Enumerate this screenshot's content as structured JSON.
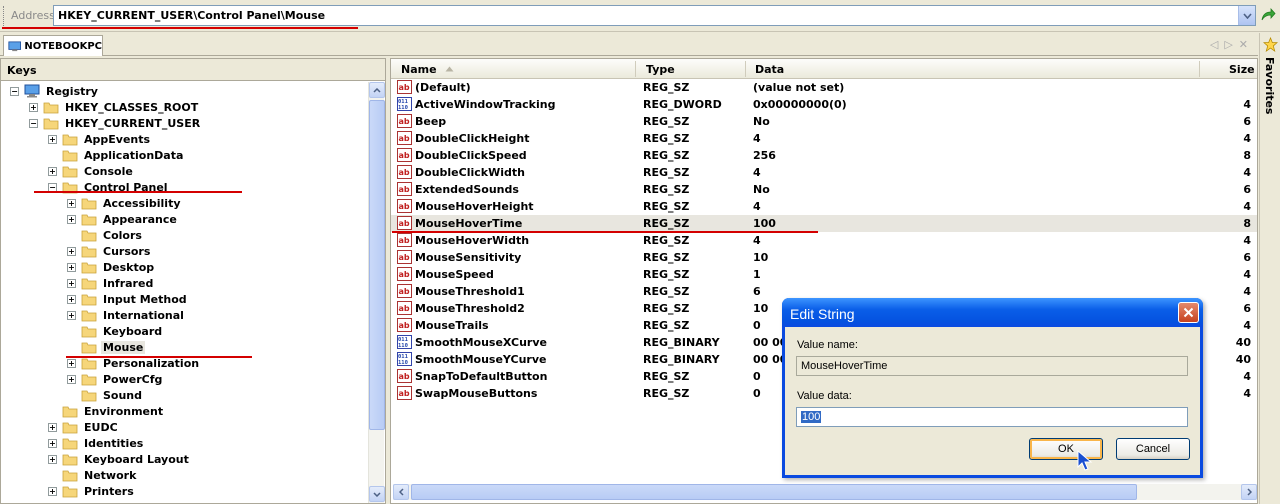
{
  "address": {
    "label": "Address",
    "path": "HKEY_CURRENT_USER\\Control Panel\\Mouse"
  },
  "tab": {
    "label": "NOTEBOOKPC"
  },
  "favorites": {
    "label": "Favorites"
  },
  "keys_pane": {
    "header": "Keys",
    "tree": [
      {
        "label": "Registry",
        "level": 0,
        "expander": "minus",
        "icon": "computer-icon"
      },
      {
        "label": "HKEY_CLASSES_ROOT",
        "level": 1,
        "expander": "plus",
        "icon": "folder-icon"
      },
      {
        "label": "HKEY_CURRENT_USER",
        "level": 1,
        "expander": "minus",
        "icon": "folder-icon"
      },
      {
        "label": "AppEvents",
        "level": 2,
        "expander": "plus",
        "icon": "folder-icon"
      },
      {
        "label": "ApplicationData",
        "level": 2,
        "expander": "none",
        "icon": "folder-icon"
      },
      {
        "label": "Console",
        "level": 2,
        "expander": "plus",
        "icon": "folder-icon"
      },
      {
        "label": "Control Panel",
        "level": 2,
        "expander": "minus",
        "icon": "folder-icon"
      },
      {
        "label": "Accessibility",
        "level": 3,
        "expander": "plus",
        "icon": "folder-icon"
      },
      {
        "label": "Appearance",
        "level": 3,
        "expander": "plus",
        "icon": "folder-icon"
      },
      {
        "label": "Colors",
        "level": 3,
        "expander": "none",
        "icon": "folder-icon"
      },
      {
        "label": "Cursors",
        "level": 3,
        "expander": "plus",
        "icon": "folder-icon"
      },
      {
        "label": "Desktop",
        "level": 3,
        "expander": "plus",
        "icon": "folder-icon"
      },
      {
        "label": "Infrared",
        "level": 3,
        "expander": "plus",
        "icon": "folder-icon"
      },
      {
        "label": "Input Method",
        "level": 3,
        "expander": "plus",
        "icon": "folder-icon"
      },
      {
        "label": "International",
        "level": 3,
        "expander": "plus",
        "icon": "folder-icon"
      },
      {
        "label": "Keyboard",
        "level": 3,
        "expander": "none",
        "icon": "folder-icon"
      },
      {
        "label": "Mouse",
        "level": 3,
        "expander": "none",
        "icon": "folder-icon",
        "selected": true
      },
      {
        "label": "Personalization",
        "level": 3,
        "expander": "plus",
        "icon": "folder-icon"
      },
      {
        "label": "PowerCfg",
        "level": 3,
        "expander": "plus",
        "icon": "folder-icon"
      },
      {
        "label": "Sound",
        "level": 3,
        "expander": "none",
        "icon": "folder-icon"
      },
      {
        "label": "Environment",
        "level": 2,
        "expander": "none",
        "icon": "folder-icon"
      },
      {
        "label": "EUDC",
        "level": 2,
        "expander": "plus",
        "icon": "folder-icon"
      },
      {
        "label": "Identities",
        "level": 2,
        "expander": "plus",
        "icon": "folder-icon"
      },
      {
        "label": "Keyboard Layout",
        "level": 2,
        "expander": "plus",
        "icon": "folder-icon"
      },
      {
        "label": "Network",
        "level": 2,
        "expander": "none",
        "icon": "folder-icon"
      },
      {
        "label": "Printers",
        "level": 2,
        "expander": "plus",
        "icon": "folder-icon"
      }
    ]
  },
  "values_pane": {
    "columns": {
      "name": "Name",
      "type": "Type",
      "data": "Data",
      "size": "Size"
    },
    "rows": [
      {
        "name": "(Default)",
        "type": "REG_SZ",
        "data": "(value not set)",
        "size": "",
        "kind": "string"
      },
      {
        "name": "ActiveWindowTracking",
        "type": "REG_DWORD",
        "data": "0x00000000(0)",
        "size": "4",
        "kind": "binary"
      },
      {
        "name": "Beep",
        "type": "REG_SZ",
        "data": "No",
        "size": "6",
        "kind": "string"
      },
      {
        "name": "DoubleClickHeight",
        "type": "REG_SZ",
        "data": "4",
        "size": "4",
        "kind": "string"
      },
      {
        "name": "DoubleClickSpeed",
        "type": "REG_SZ",
        "data": "256",
        "size": "8",
        "kind": "string"
      },
      {
        "name": "DoubleClickWidth",
        "type": "REG_SZ",
        "data": "4",
        "size": "4",
        "kind": "string"
      },
      {
        "name": "ExtendedSounds",
        "type": "REG_SZ",
        "data": "No",
        "size": "6",
        "kind": "string"
      },
      {
        "name": "MouseHoverHeight",
        "type": "REG_SZ",
        "data": "4",
        "size": "4",
        "kind": "string"
      },
      {
        "name": "MouseHoverTime",
        "type": "REG_SZ",
        "data": "100",
        "size": "8",
        "kind": "string",
        "selected": true
      },
      {
        "name": "MouseHoverWidth",
        "type": "REG_SZ",
        "data": "4",
        "size": "4",
        "kind": "string"
      },
      {
        "name": "MouseSensitivity",
        "type": "REG_SZ",
        "data": "10",
        "size": "6",
        "kind": "string"
      },
      {
        "name": "MouseSpeed",
        "type": "REG_SZ",
        "data": "1",
        "size": "4",
        "kind": "string"
      },
      {
        "name": "MouseThreshold1",
        "type": "REG_SZ",
        "data": "6",
        "size": "4",
        "kind": "string"
      },
      {
        "name": "MouseThreshold2",
        "type": "REG_SZ",
        "data": "10",
        "size": "6",
        "kind": "string"
      },
      {
        "name": "MouseTrails",
        "type": "REG_SZ",
        "data": "0",
        "size": "4",
        "kind": "string"
      },
      {
        "name": "SmoothMouseXCurve",
        "type": "REG_BINARY",
        "data": "00 00",
        "size": "40",
        "kind": "binary"
      },
      {
        "name": "SmoothMouseYCurve",
        "type": "REG_BINARY",
        "data": "00 00",
        "size": "40",
        "kind": "binary"
      },
      {
        "name": "SnapToDefaultButton",
        "type": "REG_SZ",
        "data": "0",
        "size": "4",
        "kind": "string"
      },
      {
        "name": "SwapMouseButtons",
        "type": "REG_SZ",
        "data": "0",
        "size": "4",
        "kind": "string"
      }
    ]
  },
  "dialog": {
    "title": "Edit String",
    "value_name_label": "Value name:",
    "value_name": "MouseHoverTime",
    "value_data_label": "Value data:",
    "value_data": "100",
    "ok_label": "OK",
    "cancel_label": "Cancel"
  },
  "colors": {
    "annotation_underline": "#d40000",
    "dialog_title": "#0a5ee8",
    "selection": "#316ac5"
  }
}
